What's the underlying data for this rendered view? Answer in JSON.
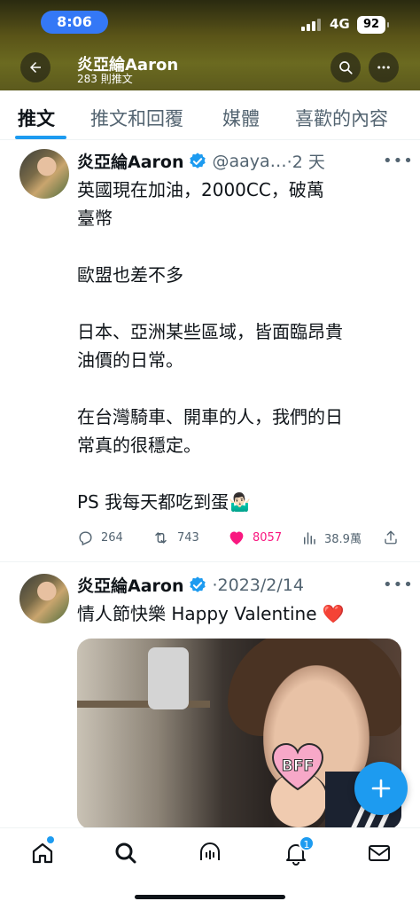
{
  "status_bar": {
    "time": "8:06",
    "network": "4G",
    "battery": "92"
  },
  "header": {
    "name": "炎亞綸Aaron",
    "post_count": "283 則推文",
    "back_icon": "arrow-left-icon",
    "search_icon": "search-icon",
    "more_icon": "more-icon"
  },
  "tabs": [
    {
      "label": "推文",
      "active": true
    },
    {
      "label": "推文和回覆",
      "active": false
    },
    {
      "label": "媒體",
      "active": false
    },
    {
      "label": "喜歡的內容",
      "active": false
    }
  ],
  "tweets": [
    {
      "name": "炎亞綸Aaron",
      "handle": "@aaya…",
      "time": "·2 天",
      "text": "英國現在加油，2000CC，破萬\n臺幣\n\n歐盟也差不多\n\n日本、亞洲某些區域，皆面臨昂貴\n油價的日常。\n\n在台灣騎車、開車的人，我們的日\n常真的很穩定。\n\nPS 我每天都吃到蛋🤷🏻‍♂️",
      "replies": "264",
      "retweets": "743",
      "likes": "8057",
      "views": "38.9萬"
    },
    {
      "name": "炎亞綸Aaron",
      "time": "·2023/2/14",
      "text": "情人節快樂 Happy Valentine ❤️",
      "photo_sticker": "BFF"
    }
  ],
  "bottom_nav": {
    "notification_count": "1"
  },
  "colors": {
    "accent": "#1d9bf0",
    "like": "#f91880",
    "muted": "#536471"
  }
}
